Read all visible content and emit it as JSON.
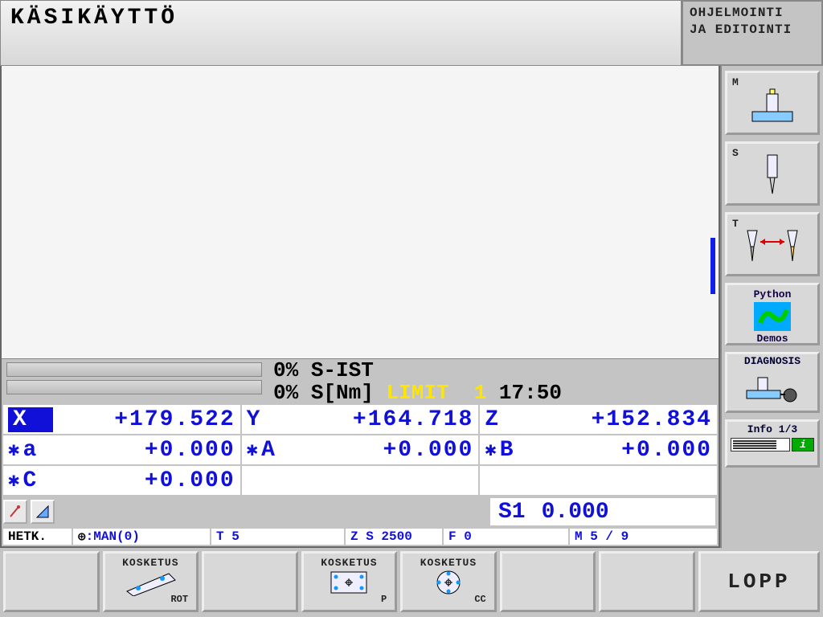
{
  "header": {
    "title": "KÄSIKÄYTTÖ",
    "mode_line1": "OHJELMOINTI",
    "mode_line2": "JA EDITOINTI"
  },
  "status": {
    "s_ist_pct": "0%",
    "s_ist_label": "S-IST",
    "s_nm_pct": "0%",
    "s_nm_label": "S[Nm]",
    "limit_label": "LIMIT",
    "limit_num": "1",
    "time": "17:50"
  },
  "dro": {
    "axes": [
      {
        "axis": "X",
        "value": "+179.522",
        "selected": true
      },
      {
        "axis": "Y",
        "value": "+164.718",
        "selected": false
      },
      {
        "axis": "Z",
        "value": "+152.834",
        "selected": false
      },
      {
        "axis": "a",
        "value": "+0.000",
        "prefix": "✱"
      },
      {
        "axis": "A",
        "value": "+0.000",
        "prefix": "✱"
      },
      {
        "axis": "B",
        "value": "+0.000",
        "prefix": "✱"
      },
      {
        "axis": "C",
        "value": "+0.000",
        "prefix": "✱"
      },
      {
        "axis": "",
        "value": ""
      },
      {
        "axis": "",
        "value": ""
      }
    ],
    "spindle": {
      "label": "S1",
      "value": "0.000"
    }
  },
  "strip": {
    "hetk": "HETK.",
    "man": ":MAN(0)",
    "t": "T 5",
    "zs": "Z S 2500",
    "f": "F 0",
    "m": "M 5 / 9"
  },
  "sidebar": {
    "m_label": "M",
    "s_label": "S",
    "t_label": "T",
    "python_top": "Python",
    "python_bottom": "Demos",
    "diagnosis": "DIAGNOSIS",
    "info": "Info 1/3"
  },
  "softkeys": {
    "kosketus": "KOSKETUS",
    "rot": "ROT",
    "p": "P",
    "cc": "CC",
    "lopp": "LOPP"
  }
}
